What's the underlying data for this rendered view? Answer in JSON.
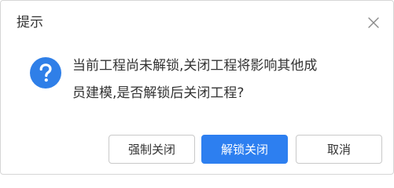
{
  "dialog": {
    "title": "提示",
    "close_icon": "close-icon",
    "message_icon": "question-icon",
    "message_line1": "当前工程尚未解锁,关闭工程将影响其他成",
    "message_line2": "员建模,是否解锁后关闭工程?",
    "buttons": {
      "force_close": "强制关闭",
      "unlock_close": "解锁关闭",
      "cancel": "取消"
    }
  },
  "colors": {
    "accent": "#2d7ff0",
    "icon_blue": "#2f7fe8",
    "text": "#333333",
    "border": "#c9c9c9"
  }
}
